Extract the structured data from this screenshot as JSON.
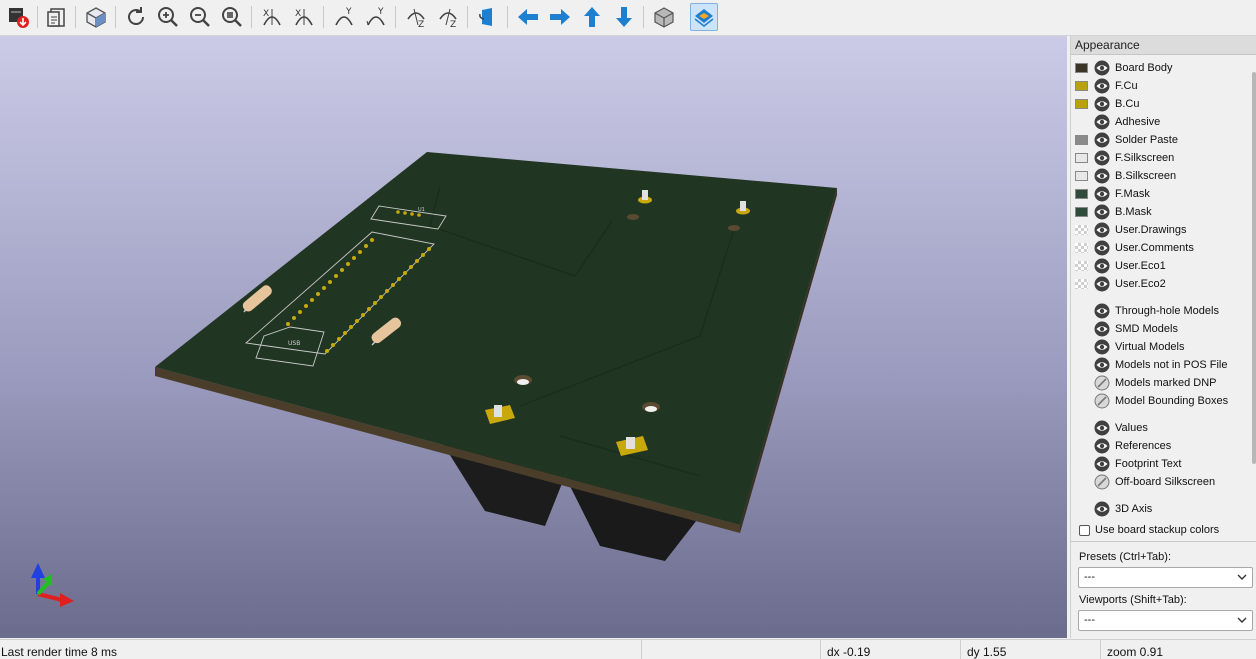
{
  "panel": {
    "title": "Appearance",
    "layers": [
      {
        "label": "Board Body",
        "color": "#3b3528",
        "swatch": "solid"
      },
      {
        "label": "F.Cu",
        "color": "#b9a20b",
        "swatch": "solid"
      },
      {
        "label": "B.Cu",
        "color": "#b9a20b",
        "swatch": "solid"
      },
      {
        "label": "Adhesive",
        "color": "",
        "swatch": "none"
      },
      {
        "label": "Solder Paste",
        "color": "#8a8a8a",
        "swatch": "solid"
      },
      {
        "label": "F.Silkscreen",
        "color": "#e8e8e8",
        "swatch": "solid"
      },
      {
        "label": "B.Silkscreen",
        "color": "#e8e8e8",
        "swatch": "solid"
      },
      {
        "label": "F.Mask",
        "color": "#2f4b3c",
        "swatch": "solid"
      },
      {
        "label": "B.Mask",
        "color": "#2f4b3c",
        "swatch": "solid"
      },
      {
        "label": "User.Drawings",
        "color": "",
        "swatch": "checker"
      },
      {
        "label": "User.Comments",
        "color": "",
        "swatch": "checker"
      },
      {
        "label": "User.Eco1",
        "color": "",
        "swatch": "checker"
      },
      {
        "label": "User.Eco2",
        "color": "",
        "swatch": "checker"
      }
    ],
    "models": [
      {
        "label": "Through-hole Models",
        "visible": true
      },
      {
        "label": "SMD Models",
        "visible": true
      },
      {
        "label": "Virtual Models",
        "visible": true
      },
      {
        "label": "Models not in POS File",
        "visible": true
      },
      {
        "label": "Models marked DNP",
        "visible": false
      },
      {
        "label": "Model Bounding Boxes",
        "visible": false
      }
    ],
    "texts": [
      {
        "label": "Values",
        "visible": true
      },
      {
        "label": "References",
        "visible": true
      },
      {
        "label": "Footprint Text",
        "visible": true
      },
      {
        "label": "Off-board Silkscreen",
        "visible": false
      }
    ],
    "axis": {
      "label": "3D Axis",
      "visible": true
    },
    "stackup_label": "Use board stackup colors",
    "presets_label": "Presets (Ctrl+Tab):",
    "presets_value": "---",
    "viewports_label": "Viewports (Shift+Tab):",
    "viewports_value": "---"
  },
  "silk": {
    "usb": "USB",
    "u1": "U1"
  },
  "status": {
    "render_time": "Last render time 8 ms",
    "dx": "dx -0.19",
    "dy": "dy 1.55",
    "zoom": "zoom 0.91"
  },
  "colors": {
    "board_top": "#203422",
    "board_edge": "#4a3d2a",
    "pad_gold": "#c9a80c",
    "axis_x": "#e02020",
    "axis_y": "#20c020",
    "axis_z": "#2040e0",
    "accent": "#1e7fd0"
  }
}
